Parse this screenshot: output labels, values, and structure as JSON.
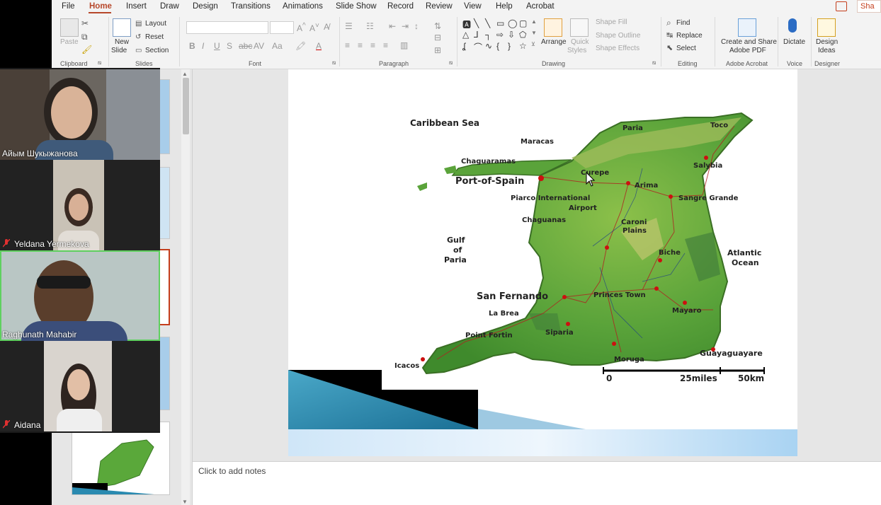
{
  "ribbon_tabs": [
    "File",
    "Home",
    "Insert",
    "Draw",
    "Design",
    "Transitions",
    "Animations",
    "Slide Show",
    "Record",
    "Review",
    "View",
    "Help",
    "Acrobat"
  ],
  "share_label": "Sha",
  "clipboard": {
    "paste": "Paste",
    "group": "Clipboard"
  },
  "slides": {
    "new_slide": "New",
    "new_slide2": "Slide",
    "layout": "Layout",
    "reset": "Reset",
    "section": "Section",
    "group": "Slides"
  },
  "font": {
    "group": "Font"
  },
  "paragraph": {
    "group": "Paragraph"
  },
  "drawing": {
    "arrange": "Arrange",
    "quick_styles": "Quick",
    "quick_styles2": "Styles",
    "shape_fill": "Shape Fill",
    "shape_outline": "Shape Outline",
    "shape_effects": "Shape Effects",
    "group": "Drawing"
  },
  "editing": {
    "find": "Find",
    "replace": "Replace",
    "select": "Select",
    "group": "Editing"
  },
  "acrobat": {
    "create": "Create and Share",
    "create2": "Adobe PDF",
    "group": "Adobe Acrobat"
  },
  "voice": {
    "dictate": "Dictate",
    "group": "Voice"
  },
  "designer": {
    "ideas": "Design",
    "ideas2": "Ideas",
    "group": "Designer"
  },
  "notes_placeholder": "Click to add notes",
  "participants": [
    {
      "name": "Айым Шукыжанова",
      "muted": false
    },
    {
      "name": "Yeldana Yermekova",
      "muted": true
    },
    {
      "name": "Raghunath Mahabir",
      "muted": false
    },
    {
      "name": "Aidana",
      "muted": true
    }
  ],
  "map": {
    "labels": {
      "caribbean_sea": "Caribbean Sea",
      "paria": "Paria",
      "toco": "Toco",
      "maracas": "Maracas",
      "chaguaramas": "Chaguaramas",
      "curepe": "Curepe",
      "salybia": "Salybia",
      "port_of_spain": "Port-of-Spain",
      "arima": "Arima",
      "piarco": "Piarco International",
      "airport": "Airport",
      "sangre_grande": "Sangre Grande",
      "chaguanas": "Chaguanas",
      "caroni": "Caroni",
      "plains": "Plains",
      "gulf": "Gulf",
      "of": "of",
      "paria_gulf": "Paria",
      "biche": "Biche",
      "atlantic": "Atlantic",
      "ocean": "Ocean",
      "san_fernando": "San Fernando",
      "princes_town": "Princes Town",
      "la_brea": "La Brea",
      "mayaro": "Mayaro",
      "point_fortin": "Point Fortin",
      "siparia": "Siparia",
      "guayaguayare": "Guayaguayare",
      "moruga": "Moruga",
      "icacos": "Icacos",
      "scale_0": "0",
      "scale_25": "25miles",
      "scale_50": "50km"
    }
  }
}
